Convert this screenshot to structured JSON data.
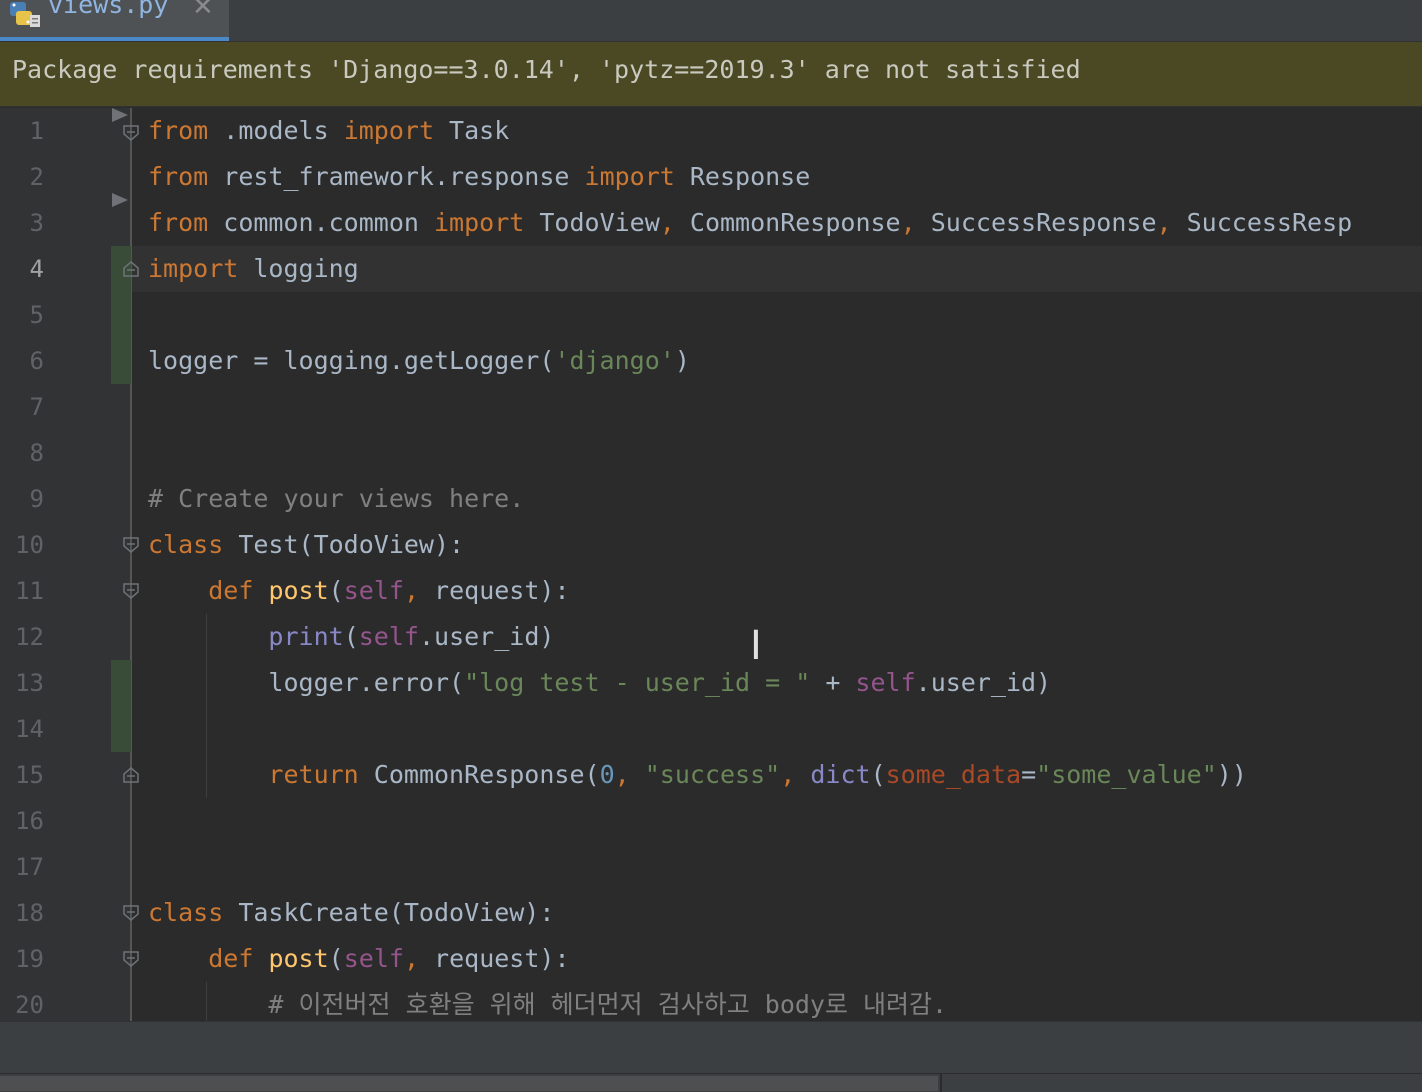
{
  "tab": {
    "label": "views.py",
    "icon": "python-icon",
    "close_symbol": "✕"
  },
  "notification": {
    "text": "Package requirements 'Django==3.0.14', 'pytz==2019.3' are not satisfied"
  },
  "editor": {
    "current_line": 4,
    "line_numbers": [
      "1",
      "2",
      "3",
      "4",
      "5",
      "6",
      "7",
      "8",
      "9",
      "10",
      "11",
      "12",
      "13",
      "14",
      "15",
      "16",
      "17",
      "18",
      "19",
      "20"
    ],
    "lines": [
      [
        {
          "t": "from",
          "c": "kw"
        },
        {
          "t": " .models ",
          "c": ""
        },
        {
          "t": "import",
          "c": "kw"
        },
        {
          "t": " Task",
          "c": ""
        }
      ],
      [
        {
          "t": "from",
          "c": "kw"
        },
        {
          "t": " rest_framework.response ",
          "c": ""
        },
        {
          "t": "import",
          "c": "kw"
        },
        {
          "t": " Response",
          "c": ""
        }
      ],
      [
        {
          "t": "from",
          "c": "kw"
        },
        {
          "t": " common.common ",
          "c": ""
        },
        {
          "t": "import",
          "c": "kw"
        },
        {
          "t": " TodoView",
          "c": ""
        },
        {
          "t": ",",
          "c": "kw"
        },
        {
          "t": " CommonResponse",
          "c": ""
        },
        {
          "t": ",",
          "c": "kw"
        },
        {
          "t": " SuccessResponse",
          "c": ""
        },
        {
          "t": ",",
          "c": "kw"
        },
        {
          "t": " SuccessResp",
          "c": ""
        }
      ],
      [
        {
          "t": "import",
          "c": "kw"
        },
        {
          "t": " logging",
          "c": ""
        }
      ],
      [],
      [
        {
          "t": "logger = logging.getLogger(",
          "c": ""
        },
        {
          "t": "'django'",
          "c": "str"
        },
        {
          "t": ")",
          "c": ""
        }
      ],
      [],
      [],
      [
        {
          "t": "# Create your views here.",
          "c": "cm"
        }
      ],
      [
        {
          "t": "class",
          "c": "kw"
        },
        {
          "t": " Test(TodoView):",
          "c": ""
        }
      ],
      [
        {
          "t": "    ",
          "c": ""
        },
        {
          "t": "def",
          "c": "kw"
        },
        {
          "t": " ",
          "c": ""
        },
        {
          "t": "post",
          "c": "fn"
        },
        {
          "t": "(",
          "c": ""
        },
        {
          "t": "self",
          "c": "self"
        },
        {
          "t": ",",
          "c": "kw"
        },
        {
          "t": " request):",
          "c": ""
        }
      ],
      [
        {
          "t": "        ",
          "c": ""
        },
        {
          "t": "print",
          "c": "bi"
        },
        {
          "t": "(",
          "c": ""
        },
        {
          "t": "self",
          "c": "self"
        },
        {
          "t": ".user_id)",
          "c": ""
        }
      ],
      [
        {
          "t": "        logger.error(",
          "c": ""
        },
        {
          "t": "\"log test - user_id = \"",
          "c": "str"
        },
        {
          "t": " + ",
          "c": ""
        },
        {
          "t": "self",
          "c": "self"
        },
        {
          "t": ".user_id)",
          "c": ""
        }
      ],
      [],
      [
        {
          "t": "        ",
          "c": ""
        },
        {
          "t": "return",
          "c": "kw"
        },
        {
          "t": " CommonResponse(",
          "c": ""
        },
        {
          "t": "0",
          "c": "num"
        },
        {
          "t": ",",
          "c": "kw"
        },
        {
          "t": " ",
          "c": ""
        },
        {
          "t": "\"success\"",
          "c": "str"
        },
        {
          "t": ",",
          "c": "kw"
        },
        {
          "t": " ",
          "c": ""
        },
        {
          "t": "dict",
          "c": "bi"
        },
        {
          "t": "(",
          "c": ""
        },
        {
          "t": "some_data",
          "c": "param"
        },
        {
          "t": "=",
          "c": ""
        },
        {
          "t": "\"some_value\"",
          "c": "str"
        },
        {
          "t": "))",
          "c": ""
        }
      ],
      [],
      [],
      [
        {
          "t": "class",
          "c": "kw"
        },
        {
          "t": " TaskCreate(TodoView):",
          "c": ""
        }
      ],
      [
        {
          "t": "    ",
          "c": ""
        },
        {
          "t": "def",
          "c": "kw"
        },
        {
          "t": " ",
          "c": ""
        },
        {
          "t": "post",
          "c": "fn"
        },
        {
          "t": "(",
          "c": ""
        },
        {
          "t": "self",
          "c": "self"
        },
        {
          "t": ",",
          "c": "kw"
        },
        {
          "t": " request):",
          "c": ""
        }
      ],
      [
        {
          "t": "        # 이전버전 호환을 위해 헤더먼저 검사하고 body로 내려감.",
          "c": "cm"
        }
      ]
    ]
  },
  "colors": {
    "background": "#2b2b2b",
    "keyword": "#cc7832",
    "string": "#6a8759",
    "comment": "#808080",
    "function": "#ffc66d",
    "self": "#94558d",
    "number": "#6897bb",
    "builtin": "#8888c6",
    "param": "#aa4926",
    "notification_bg": "#4a4923"
  }
}
